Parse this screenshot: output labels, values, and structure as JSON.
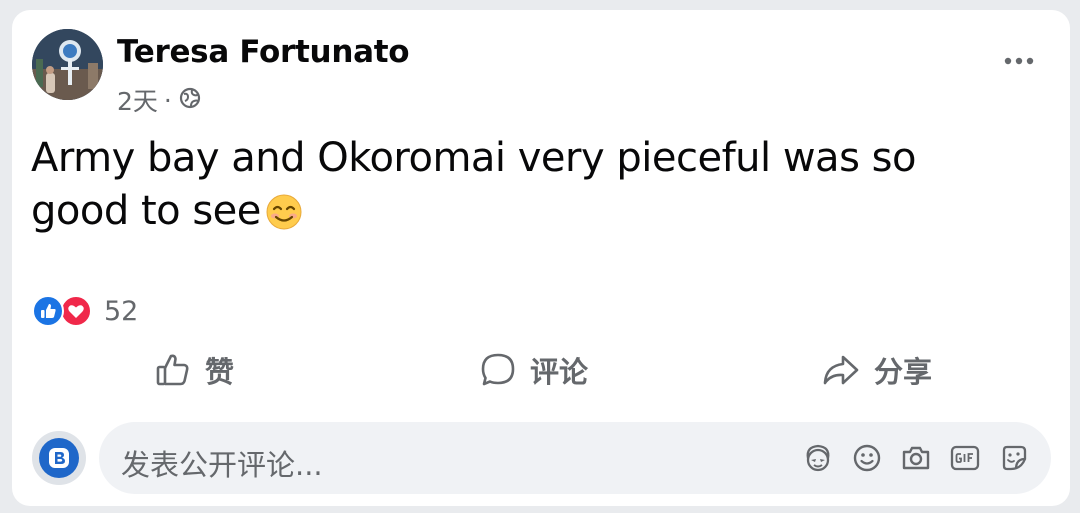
{
  "post": {
    "author": "Teresa Fortunato",
    "time": "2天",
    "separator": "·",
    "privacy_icon": "globe-icon",
    "text_line1": "Army bay and Okoromai very pieceful was so",
    "text_line2": "good to see",
    "emoji": "smiling-face-emoji"
  },
  "reactions": {
    "types": [
      "like",
      "love"
    ],
    "count": "52"
  },
  "actions": {
    "like_label": "赞",
    "comment_label": "评论",
    "share_label": "分享"
  },
  "composer": {
    "placeholder": "发表公开评论...",
    "tools": [
      "avatar-sticker-icon",
      "emoji-icon",
      "camera-icon",
      "gif-icon",
      "sticker-icon"
    ]
  },
  "colors": {
    "accent": "#1b74e4",
    "love": "#f0284a",
    "secondary_text": "#65686c",
    "primary_text": "#080809"
  }
}
